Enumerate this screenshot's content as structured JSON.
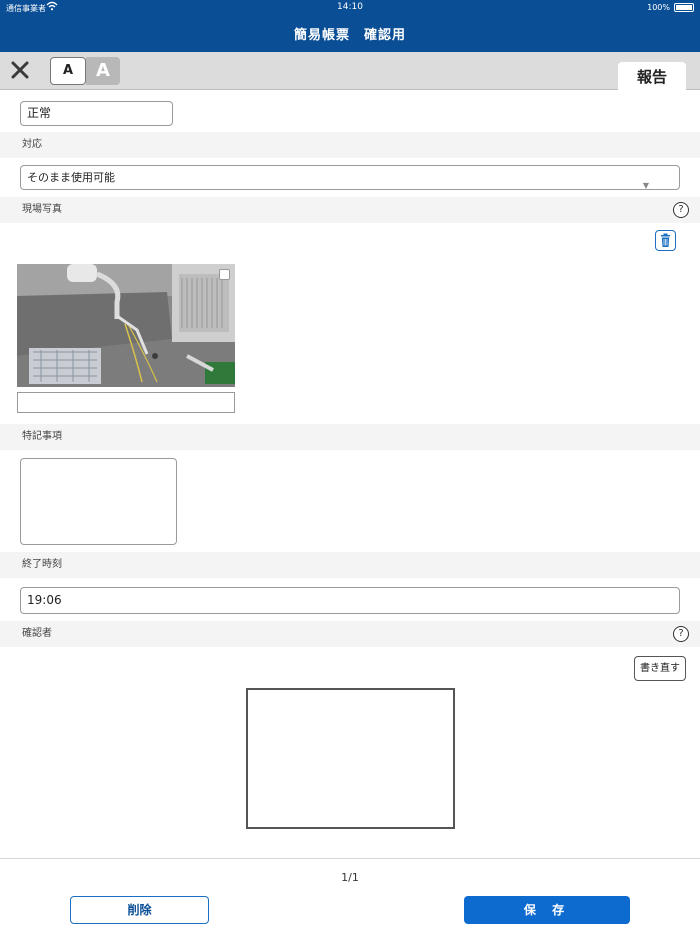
{
  "status_bar": {
    "carrier": "通信事業者",
    "time": "14:10",
    "battery": "100%"
  },
  "header": {
    "title": "簡易帳票　確認用"
  },
  "toolbar": {
    "font_small_label": "A",
    "font_large_label": "A",
    "report_tab": "報告"
  },
  "form": {
    "status_value": "正常",
    "response_label": "対応",
    "response_value": "そのまま使用可能",
    "photo_label": "現場写真",
    "notes_label": "特記事項",
    "end_time_label": "終了時刻",
    "end_time_value": "19:06",
    "confirmer_label": "確認者",
    "rewrite_label": "書き直す",
    "help_glyph": "?"
  },
  "footer": {
    "pager": "1/1",
    "delete_label": "削除",
    "save_label": "保 存"
  },
  "colors": {
    "header_bg": "#0a4f96",
    "accent": "#0d6bd0"
  }
}
